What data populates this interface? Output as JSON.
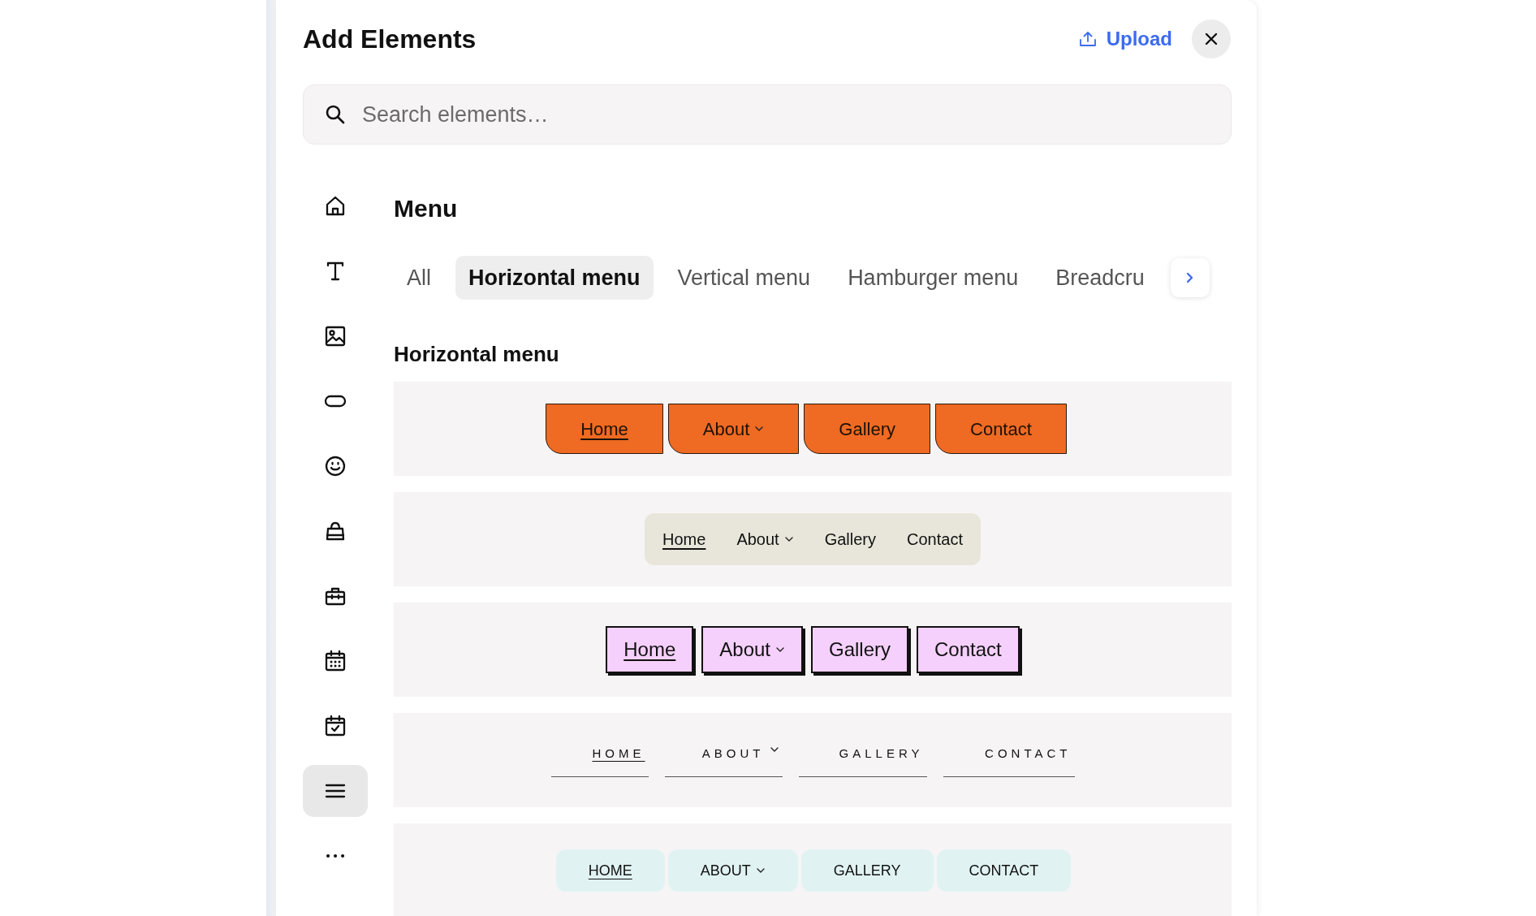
{
  "panel": {
    "title": "Add Elements",
    "upload_label": "Upload"
  },
  "search": {
    "placeholder": "Search elements…"
  },
  "sidebar": {
    "items": [
      {
        "kind": "home",
        "selected": false
      },
      {
        "kind": "text",
        "selected": false
      },
      {
        "kind": "image",
        "selected": false
      },
      {
        "kind": "button",
        "selected": false
      },
      {
        "kind": "emoji",
        "selected": false
      },
      {
        "kind": "bag",
        "selected": false
      },
      {
        "kind": "briefcase",
        "selected": false
      },
      {
        "kind": "calendar",
        "selected": false
      },
      {
        "kind": "calendar-check",
        "selected": false
      },
      {
        "kind": "menu",
        "selected": true
      },
      {
        "kind": "more",
        "selected": false
      }
    ]
  },
  "section": {
    "title": "Menu"
  },
  "tabs": [
    {
      "label": "All",
      "selected": false
    },
    {
      "label": "Horizontal menu",
      "selected": true
    },
    {
      "label": "Vertical menu",
      "selected": false
    },
    {
      "label": "Hamburger menu",
      "selected": false
    },
    {
      "label": "Breadcru",
      "selected": false
    }
  ],
  "group": {
    "title": "Horizontal menu"
  },
  "menus": [
    {
      "kind": "orange-tabs",
      "items": [
        {
          "label": "Home",
          "selected": true,
          "dropdown": false
        },
        {
          "label": "About",
          "selected": false,
          "dropdown": true
        },
        {
          "label": "Gallery",
          "selected": false,
          "dropdown": false
        },
        {
          "label": "Contact",
          "selected": false,
          "dropdown": false
        }
      ]
    },
    {
      "kind": "pill-bar",
      "items": [
        {
          "label": "Home",
          "selected": true,
          "dropdown": false
        },
        {
          "label": "About",
          "selected": false,
          "dropdown": true
        },
        {
          "label": "Gallery",
          "selected": false,
          "dropdown": false
        },
        {
          "label": "Contact",
          "selected": false,
          "dropdown": false
        }
      ]
    },
    {
      "kind": "boxed",
      "items": [
        {
          "label": "Home",
          "selected": true,
          "dropdown": false
        },
        {
          "label": "About",
          "selected": false,
          "dropdown": true
        },
        {
          "label": "Gallery",
          "selected": false,
          "dropdown": false
        },
        {
          "label": "Contact",
          "selected": false,
          "dropdown": false
        }
      ]
    },
    {
      "kind": "spaced-caps",
      "items": [
        {
          "label": "HOME",
          "selected": true,
          "dropdown": false
        },
        {
          "label": "ABOUT",
          "selected": false,
          "dropdown": true
        },
        {
          "label": "GALLERY",
          "selected": false,
          "dropdown": false
        },
        {
          "label": "CONTACT",
          "selected": false,
          "dropdown": false
        }
      ]
    },
    {
      "kind": "mint",
      "items": [
        {
          "label": "HOME",
          "selected": true,
          "dropdown": false
        },
        {
          "label": "ABOUT",
          "selected": false,
          "dropdown": true
        },
        {
          "label": "GALLERY",
          "selected": false,
          "dropdown": false
        },
        {
          "label": "CONTACT",
          "selected": false,
          "dropdown": false
        }
      ]
    }
  ]
}
